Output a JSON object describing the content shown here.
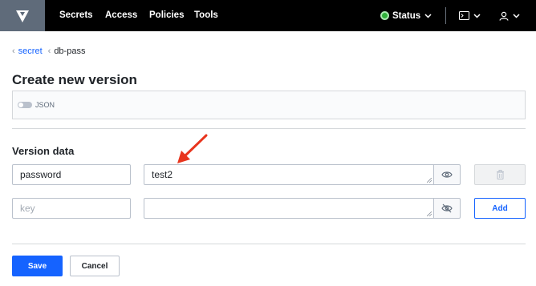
{
  "nav": {
    "links": [
      "Secrets",
      "Access",
      "Policies",
      "Tools"
    ],
    "status_label": "Status",
    "status_color": "#2eb039"
  },
  "breadcrumb": {
    "parent": "secret",
    "current": "db-pass"
  },
  "page": {
    "title": "Create new version",
    "json_toggle_label": "JSON"
  },
  "version_data": {
    "title": "Version data",
    "rows": [
      {
        "key": "password",
        "value": "test2"
      }
    ],
    "new_key_placeholder": "key",
    "add_label": "Add"
  },
  "actions": {
    "save_label": "Save",
    "cancel_label": "Cancel"
  },
  "colors": {
    "accent": "#1563ff",
    "annotation_arrow": "#e8351e"
  },
  "icons": [
    "vault-logo-icon",
    "chevron-down-icon",
    "terminal-icon",
    "user-icon",
    "eye-icon",
    "eye-off-icon",
    "trash-icon"
  ]
}
